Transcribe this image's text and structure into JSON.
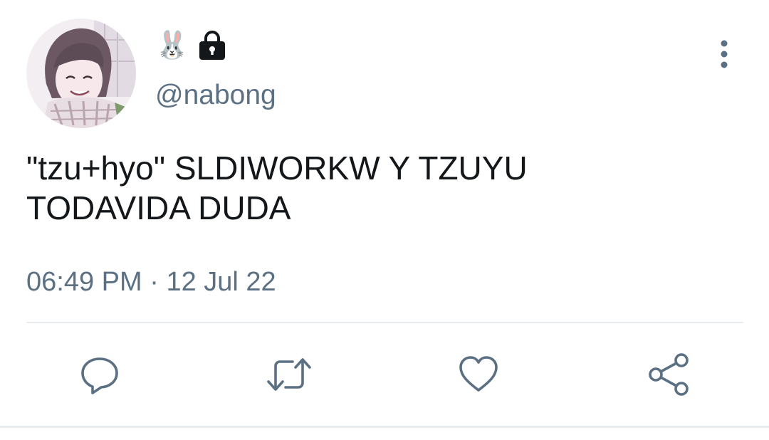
{
  "user": {
    "display_name": "🐰",
    "handle": "@nabong",
    "avatar_icon": "avatar-illustration",
    "protected_icon": "lock-icon"
  },
  "menu": {
    "icon": "more-vertical-icon"
  },
  "tweet": {
    "text": "\"tzu+hyo\" SLDIWORKW Y TZUYU\nTODAVIDA DUDA",
    "time": "06:49 PM",
    "separator": "·",
    "date": "12 Jul 22"
  },
  "actions": [
    {
      "name": "reply",
      "icon": "reply-icon"
    },
    {
      "name": "retweet",
      "icon": "retweet-icon"
    },
    {
      "name": "like",
      "icon": "heart-icon"
    },
    {
      "name": "share",
      "icon": "share-icon"
    }
  ],
  "colors": {
    "text": "#14171a",
    "secondary": "#5b7083",
    "divider": "#e6ecf0",
    "icon": "#5b7083"
  }
}
